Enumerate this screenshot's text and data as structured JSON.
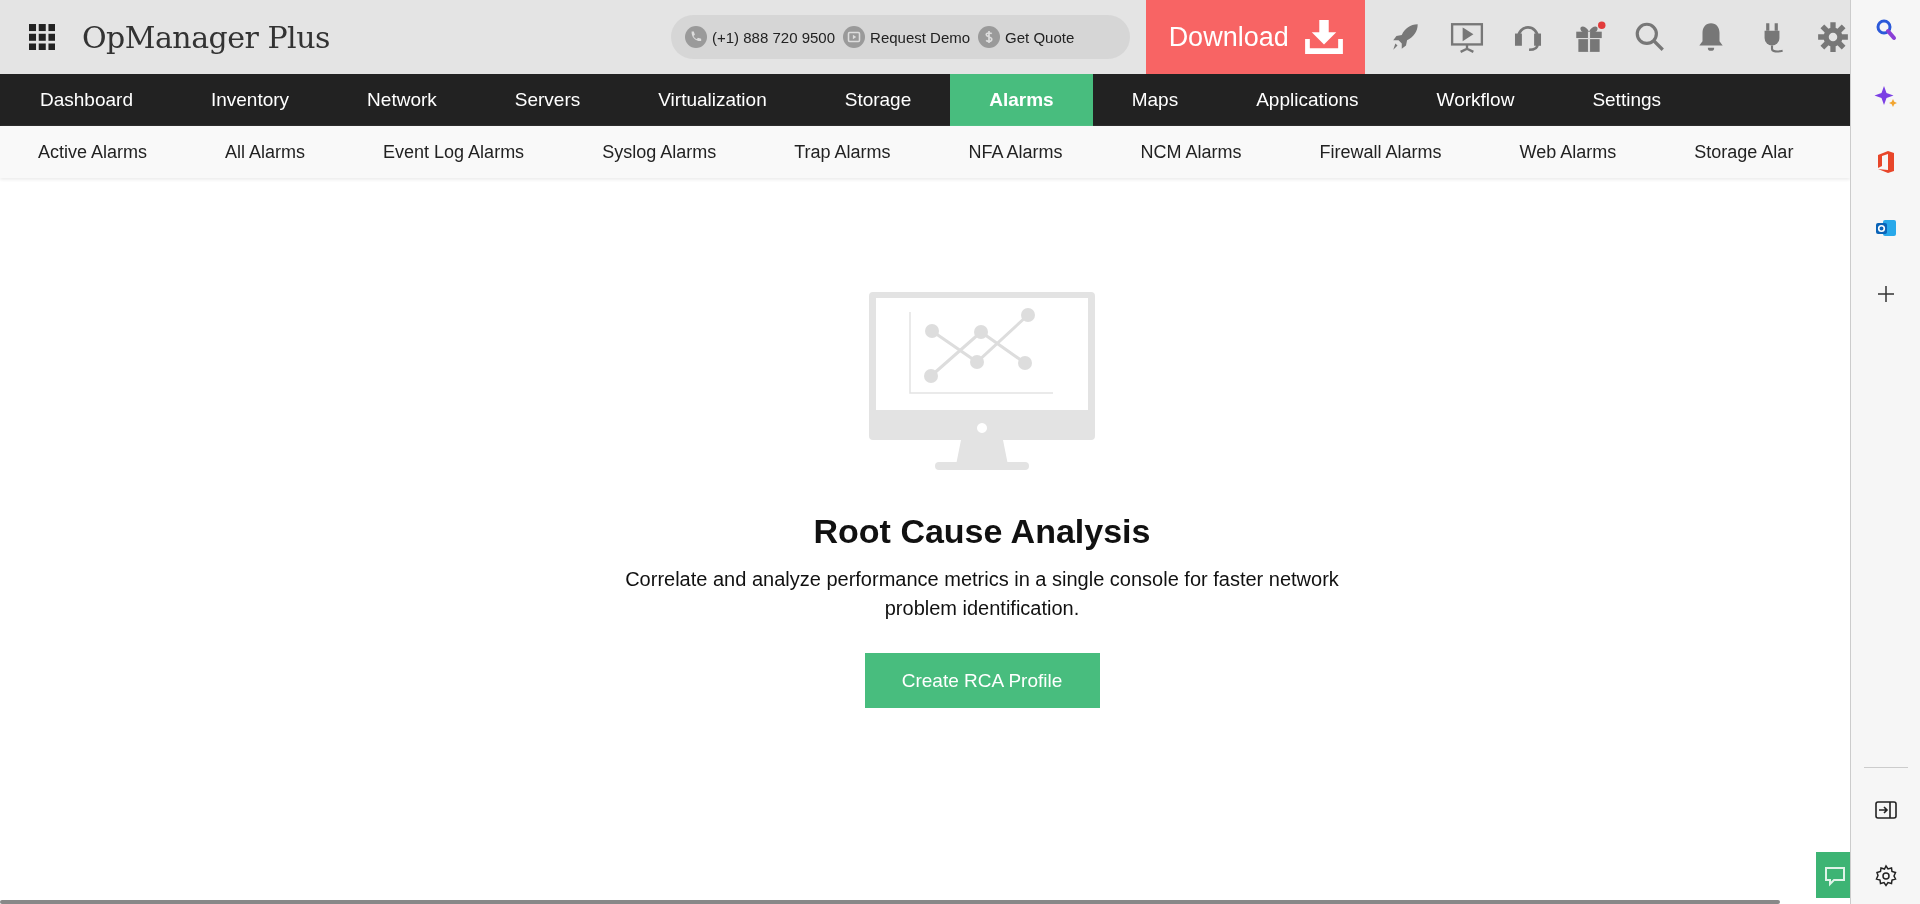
{
  "app": {
    "title": "OpManager Plus"
  },
  "contact": [
    {
      "kind": "phone",
      "label": "(+1) 888 720 9500"
    },
    {
      "kind": "demo",
      "label": "Request Demo"
    },
    {
      "kind": "quote",
      "label": "Get Quote"
    }
  ],
  "download": {
    "label": "Download"
  },
  "toolbar": [
    {
      "kind": "rocket"
    },
    {
      "kind": "presentation"
    },
    {
      "kind": "headset"
    },
    {
      "kind": "gift",
      "badge": true
    },
    {
      "kind": "search"
    },
    {
      "kind": "bell"
    },
    {
      "kind": "plug"
    },
    {
      "kind": "gear"
    }
  ],
  "tabs": [
    {
      "label": "Dashboard",
      "selected": false
    },
    {
      "label": "Inventory",
      "selected": false
    },
    {
      "label": "Network",
      "selected": false
    },
    {
      "label": "Servers",
      "selected": false
    },
    {
      "label": "Virtualization",
      "selected": false
    },
    {
      "label": "Storage",
      "selected": false
    },
    {
      "label": "Alarms",
      "selected": true
    },
    {
      "label": "Maps",
      "selected": false
    },
    {
      "label": "Applications",
      "selected": false
    },
    {
      "label": "Workflow",
      "selected": false
    },
    {
      "label": "Settings",
      "selected": false
    }
  ],
  "subtabs": [
    "Active Alarms",
    "All Alarms",
    "Event Log Alarms",
    "Syslog Alarms",
    "Trap Alarms",
    "NFA Alarms",
    "NCM Alarms",
    "Firewall Alarms",
    "Web Alarms",
    "Storage Alar"
  ],
  "empty_state": {
    "title": "Root Cause Analysis",
    "description": "Correlate and analyze performance metrics in a single console for faster network problem identification.",
    "button": "Create RCA Profile"
  },
  "sidebar": [
    {
      "kind": "search"
    },
    {
      "kind": "sparkle"
    },
    {
      "kind": "office"
    },
    {
      "kind": "outlook"
    },
    {
      "kind": "add"
    }
  ],
  "sidebar_bottom": [
    {
      "kind": "panel"
    },
    {
      "kind": "settings"
    }
  ]
}
